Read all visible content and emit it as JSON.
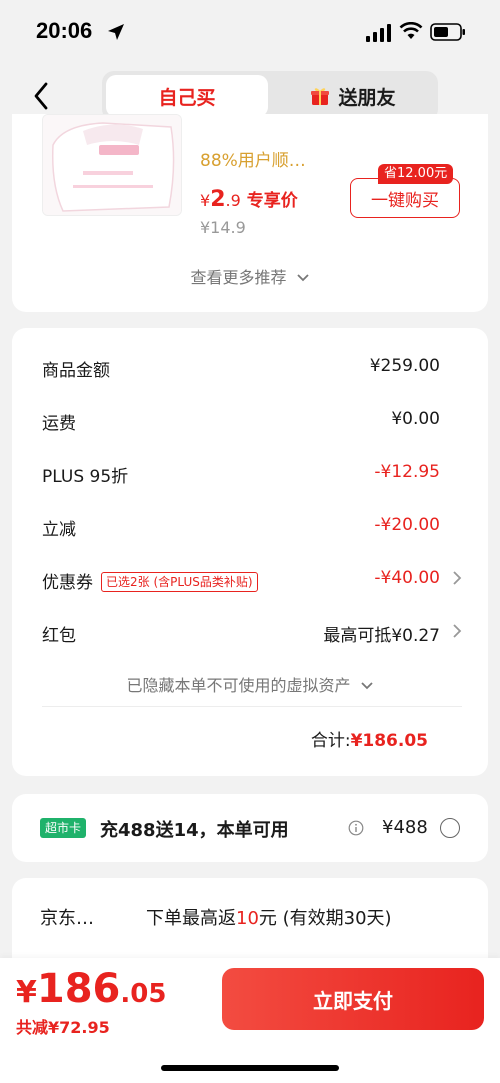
{
  "status_bar": {
    "time": "20:06"
  },
  "nav": {
    "tab_self": "自己买",
    "tab_gift": "送朋友"
  },
  "recommendation": {
    "cut_title": "",
    "satisfaction": "88%用户顺…",
    "price_symbol": "¥",
    "price_int": "2",
    "price_dec": ".9",
    "price_tag": "专享价",
    "original_price": "¥14.9",
    "save_badge": "省12.00元",
    "buy_button": "一键购买",
    "more": "查看更多推荐"
  },
  "summary": {
    "rows": [
      {
        "label": "商品金额",
        "value": "¥259.00"
      },
      {
        "label": "运费",
        "value": "¥0.00"
      },
      {
        "label": "PLUS 95折",
        "value": "-¥12.95"
      },
      {
        "label": "立减",
        "value": "-¥20.00"
      },
      {
        "label": "优惠券",
        "tag": "已选2张 (含PLUS品类补贴)",
        "value": "-¥40.00"
      },
      {
        "label": "红包",
        "value": "最高可抵¥0.27"
      }
    ],
    "hidden_assets": "已隐藏本单不可使用的虚拟资产",
    "total_label": "合计:",
    "total_value": "¥186.05"
  },
  "market_card": {
    "badge": "超市卡",
    "text": "充488送14，本单可用",
    "price": "¥488"
  },
  "jd_offer": {
    "name": "京东…",
    "text_prefix": "下单最高返",
    "amount": "10",
    "text_suffix": "元 (有效期30天)"
  },
  "payment": {
    "yen": "¥",
    "amount_int": "186",
    "amount_dec": ".05",
    "saved": "共减¥72.95",
    "pay_button": "立即支付"
  },
  "colors": {
    "accent": "#e8231f",
    "market_green": "#1fb26b",
    "satisfaction": "#d8a030"
  }
}
